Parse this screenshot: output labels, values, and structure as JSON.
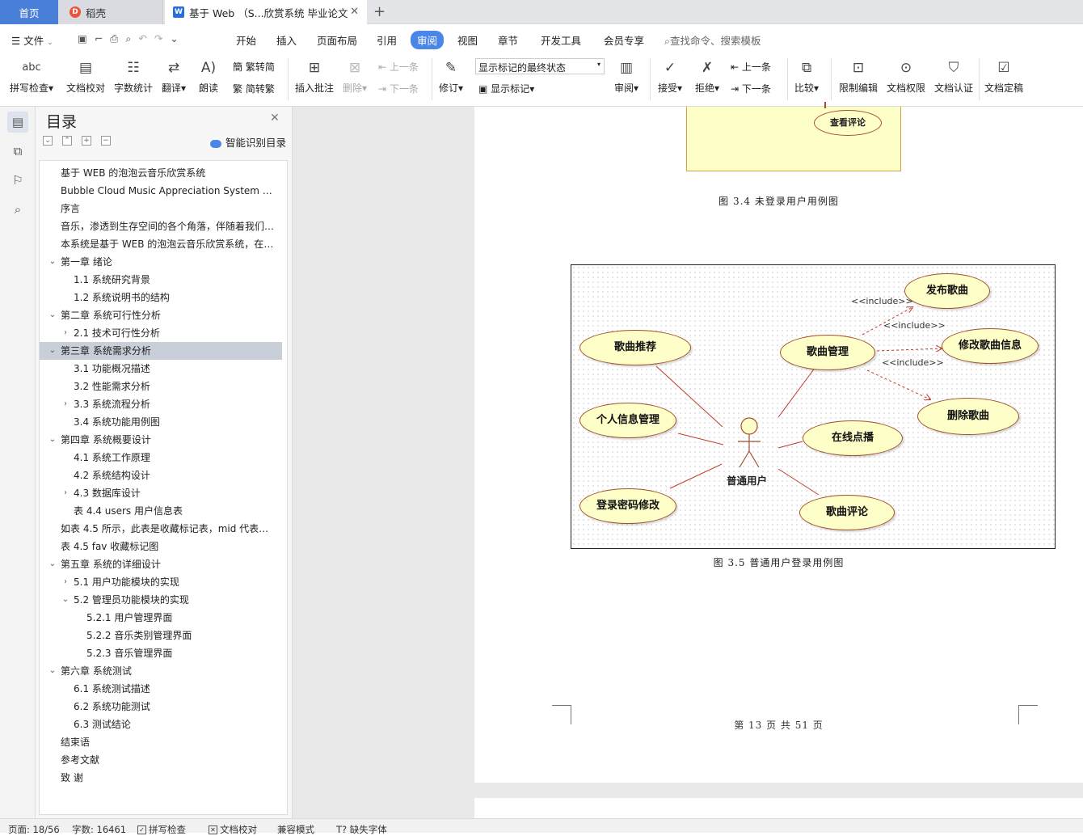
{
  "tabs": {
    "home": "首页",
    "daoke": "稻壳",
    "doc": "基于 Web （S...欣赏系统 毕业论文",
    "add": "+"
  },
  "menu": {
    "file": "文件",
    "items": [
      "开始",
      "插入",
      "页面布局",
      "引用",
      "审阅",
      "视图",
      "章节",
      "开发工具",
      "会员专享"
    ],
    "search": "查找命令、搜索模板"
  },
  "ribbon": {
    "spellcheck": "拼写检查",
    "proofread": "文档校对",
    "wordcount": "字数统计",
    "translate": "翻译",
    "read_aloud": "朗读",
    "trad": "繁转简",
    "simp": "简转繁",
    "insert_comment": "插入批注",
    "delete": "删除",
    "prev": "上一条",
    "next": "下一条",
    "track": "修订",
    "markup_state": "显示标记的最终状态",
    "show_markup": "显示标记",
    "review": "审阅",
    "accept": "接受",
    "reject": "拒绝",
    "prev2": "上一条",
    "next2": "下一条",
    "compare": "比较",
    "restrict": "限制编辑",
    "permission": "文档权限",
    "certify": "文档认证",
    "finalize": "文档定稿"
  },
  "toc": {
    "title": "目录",
    "smart": "智能识别目录",
    "items": [
      "基于 WEB 的泡泡云音乐欣赏系统",
      "Bubble Cloud Music Appreciation System Based on WEB",
      "序言",
      "音乐，渗透到生存空间的各个角落，伴随着我们的生活",
      "本系统是基于 WEB 的泡泡云音乐欣赏系统，在设计上",
      "第一章  绪论",
      "1.1  系统研究背景",
      "1.2  系统说明书的结构",
      "第二章  系统可行性分析",
      "2.1  技术可行性分析",
      "第三章  系统需求分析",
      "3.1  功能概况描述",
      "3.2 性能需求分析",
      "3.3 系统流程分析",
      "3.4 系统功能用例图",
      "第四章  系统概要设计",
      "4.1 系统工作原理",
      "4.2  系统结构设计",
      "4.3  数据库设计",
      "表 4.4 users 用户信息表",
      "如表 4.5 所示，此表是收藏标记表，mid 代表歌曲编号",
      "表 4.5 fav 收藏标记图",
      "第五章  系统的详细设计",
      "5.1  用户功能模块的实现",
      "5.2  管理员功能模块的实现",
      "5.2.1 用户管理界面",
      "5.2.2 音乐类别管理界面",
      "5.2.3 音乐管理界面",
      "第六章    系统测试",
      "6.1 系统测试描述",
      "6.2 系统功能测试",
      "6.3 测试结论",
      "结束语",
      "参考文献",
      "致    谢"
    ]
  },
  "document": {
    "uc_view_comment": "查看评论",
    "caption_34": "图 3.4 未登录用户用例图",
    "caption_35": "图 3.5 普通用户登录用例图",
    "actor": "普通用户",
    "use_cases": {
      "recommend": "歌曲推荐",
      "profile": "个人信息管理",
      "password": "登录密码修改",
      "manage": "歌曲管理",
      "play": "在线点播",
      "comment": "歌曲评论",
      "publish": "发布歌曲",
      "edit": "修改歌曲信息",
      "delete": "删除歌曲"
    },
    "include_label": "<<include>>",
    "page_number": "第 13 页 共 51 页"
  },
  "status": {
    "page": "页面: 18/56",
    "words": "字数: 16461",
    "spell": "拼写检查",
    "proof": "文档校对",
    "compat": "兼容模式",
    "missing_font": "缺失字体"
  },
  "colors": {
    "accent": "#4a86e8",
    "usecase_fill": "#fefec8",
    "usecase_border": "#a0522d",
    "include_line": "#c0392b"
  }
}
